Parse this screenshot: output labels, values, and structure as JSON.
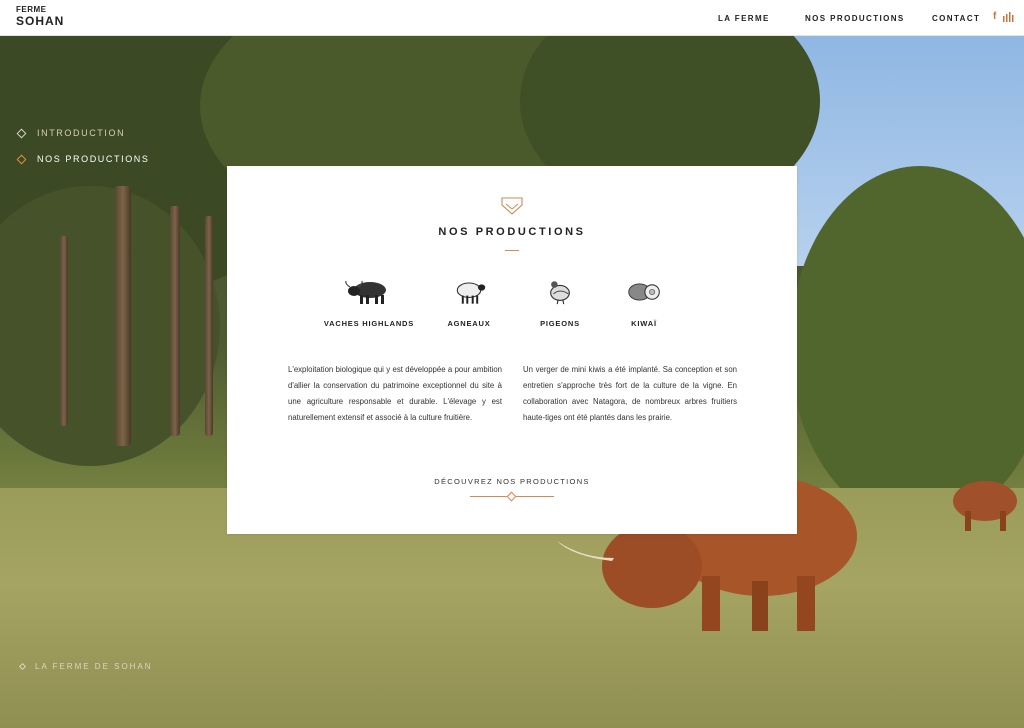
{
  "header": {
    "logo_line1": "FERME",
    "logo_line2": "SOHAN",
    "nav": [
      "LA FERME",
      "NOS PRODUCTIONS",
      "CONTACT"
    ],
    "social_icons": [
      "facebook-icon",
      "soundcloud-icon"
    ]
  },
  "sidenav": {
    "items": [
      {
        "label": "INTRODUCTION",
        "active": false
      },
      {
        "label": "NOS PRODUCTIONS",
        "active": true
      }
    ]
  },
  "footer": {
    "brand": "LA FERME DE SOHAN"
  },
  "card": {
    "title": "NOS PRODUCTIONS",
    "products": [
      {
        "label": "VACHES HIGHLANDS",
        "icon": "cow-icon"
      },
      {
        "label": "AGNEAUX",
        "icon": "sheep-icon"
      },
      {
        "label": "PIGEONS",
        "icon": "pigeon-icon"
      },
      {
        "label": "KIWAÏ",
        "icon": "kiwi-icon"
      }
    ],
    "paragraph_left": "L'exploitation biologique qui y est développée a pour ambition d'allier la conservation du patrimoine exceptionnel du site à une agriculture responsable et durable. L'élevage y est naturellement extensif et associé à la culture fruitière.",
    "paragraph_right": "Un verger de mini kiwis a été implanté. Sa conception et son entretien s'approche très fort de la culture de la vigne. En collaboration avec Natagora, de nombreux arbres fruitiers haute-tiges ont été plantés dans les prairie.",
    "cta": "DÉCOUVREZ NOS PRODUCTIONS"
  },
  "colors": {
    "accent": "#d08a55",
    "text": "#222222",
    "card_bg": "#ffffff"
  }
}
